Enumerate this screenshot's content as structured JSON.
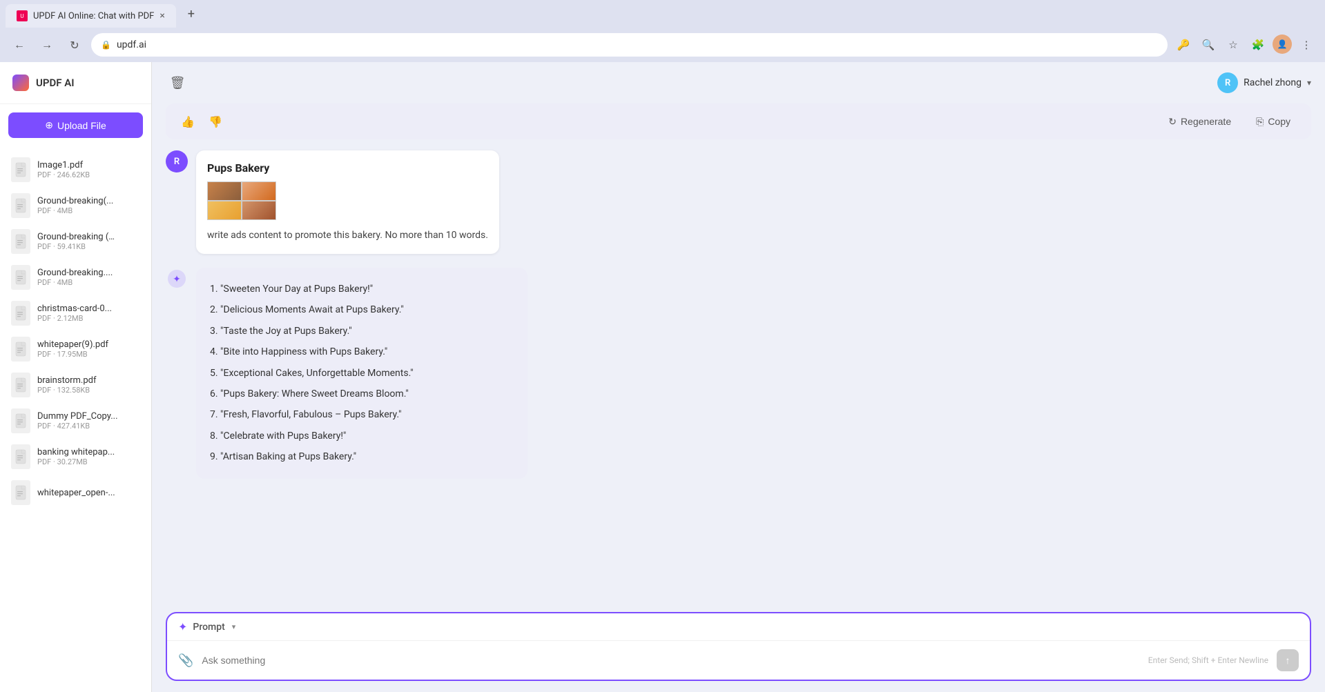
{
  "browser": {
    "tab": {
      "title": "UPDF AI Online: Chat with PDF",
      "favicon_label": "U",
      "close_label": "×"
    },
    "new_tab_label": "+",
    "address": "updf.ai",
    "nav_back": "←",
    "nav_forward": "→",
    "nav_refresh": "↻"
  },
  "sidebar": {
    "app_title": "UPDF AI",
    "upload_button_label": "Upload File",
    "files": [
      {
        "name": "Image1.pdf",
        "meta": "PDF · 246.62KB"
      },
      {
        "name": "Ground-breaking(...",
        "meta": "PDF · 4MB"
      },
      {
        "name": "Ground-breaking (…",
        "meta": "PDF · 59.41KB"
      },
      {
        "name": "Ground-breaking....",
        "meta": "PDF · 4MB"
      },
      {
        "name": "christmas-card-0...",
        "meta": "PDF · 2.12MB"
      },
      {
        "name": "whitepaper(9).pdf",
        "meta": "PDF · 17.95MB"
      },
      {
        "name": "brainstorm.pdf",
        "meta": "PDF · 132.58KB"
      },
      {
        "name": "Dummy PDF_Copy...",
        "meta": "PDF · 427.41KB"
      },
      {
        "name": "banking whitepap...",
        "meta": "PDF · 30.27MB"
      },
      {
        "name": "whitepaper_open-...",
        "meta": ""
      }
    ]
  },
  "toolbar": {
    "trash_icon": "🗑",
    "user_name": "Rachel zhong",
    "user_avatar_letter": "R"
  },
  "chat": {
    "actions_bar": {
      "thumbs_up_icon": "👍",
      "thumbs_down_icon": "👎",
      "regenerate_label": "Regenerate",
      "copy_label": "Copy"
    },
    "user_message": {
      "avatar_letter": "R",
      "bakery_name": "Pups Bakery",
      "prompt_text": "write ads content to promote this bakery. No more than 10 words."
    },
    "ai_message": {
      "avatar_icon": "✨",
      "items": [
        "\"Sweeten Your Day at Pups Bakery!\"",
        "\"Delicious Moments Await at Pups Bakery.\"",
        "\"Taste the Joy at Pups Bakery.\"",
        "\"Bite into Happiness with Pups Bakery.\"",
        "\"Exceptional Cakes, Unforgettable Moments.\"",
        "\"Pups Bakery: Where Sweet Dreams Bloom.\"",
        "\"Fresh, Flavorful, Fabulous – Pups Bakery.\"",
        "\"Celebrate with Pups Bakery!\"",
        "\"Artisan Baking at Pups Bakery.\""
      ]
    }
  },
  "input": {
    "prompt_label": "Prompt",
    "prompt_chevron": "▾",
    "placeholder": "Ask something",
    "hint": "Enter Send; Shift + Enter Newline",
    "send_icon": "↑"
  }
}
